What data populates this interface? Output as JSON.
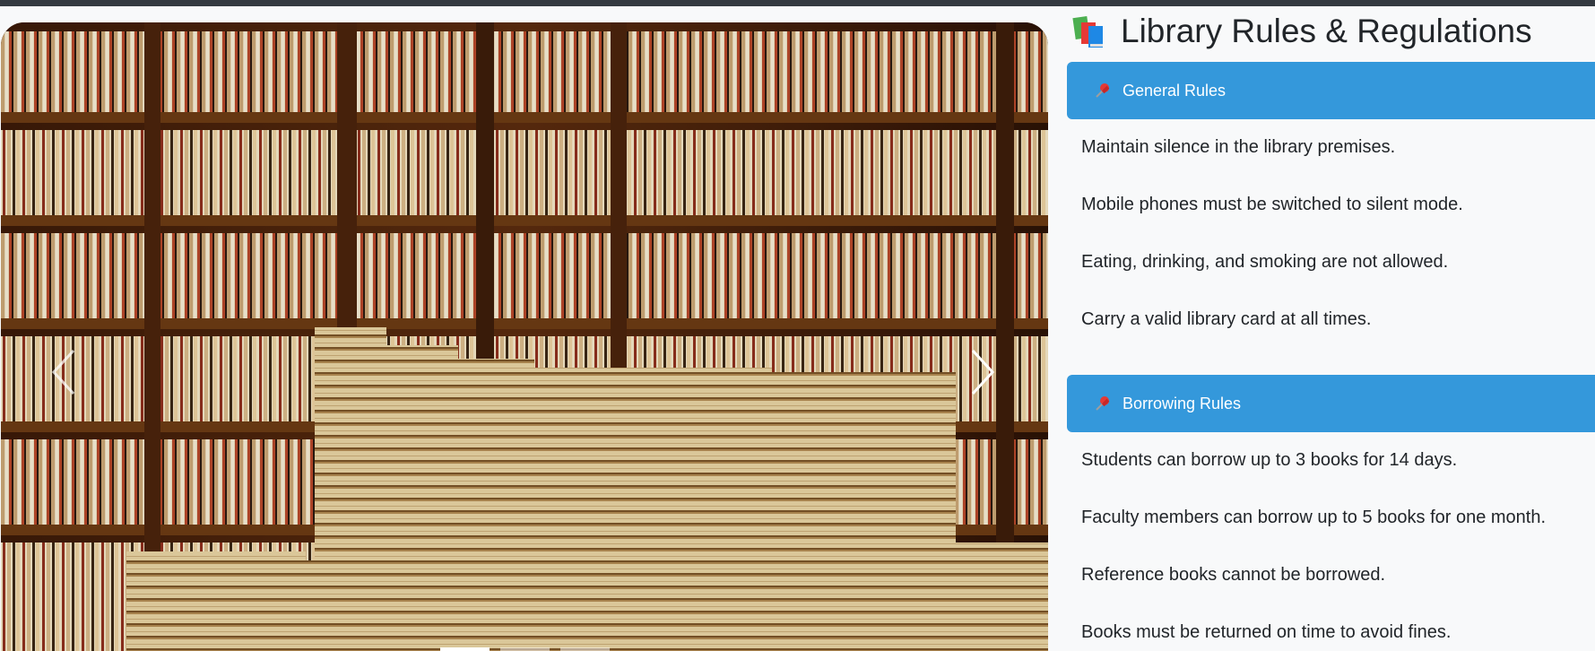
{
  "page": {
    "title": "Library Rules & Regulations",
    "title_icon": "books-icon"
  },
  "carousel": {
    "image_description_icon": "bookshelf-photo",
    "prev_icon": "chevron-left-icon",
    "next_icon": "chevron-right-icon",
    "indicator_count": 3,
    "active_index": 0
  },
  "sections": [
    {
      "icon": "pushpin-icon",
      "heading": "General Rules",
      "rules": [
        "Maintain silence in the library premises.",
        "Mobile phones must be switched to silent mode.",
        "Eating, drinking, and smoking are not allowed.",
        "Carry a valid library card at all times."
      ]
    },
    {
      "icon": "pushpin-icon",
      "heading": "Borrowing Rules",
      "rules": [
        "Students can borrow up to 3 books for 14 days.",
        "Faculty members can borrow up to 5 books for one month.",
        "Reference books cannot be borrowed.",
        "Books must be returned on time to avoid fines."
      ]
    }
  ],
  "colors": {
    "section_header": "#3498db",
    "top_bar": "#343a40",
    "background": "#f8f9fa"
  }
}
